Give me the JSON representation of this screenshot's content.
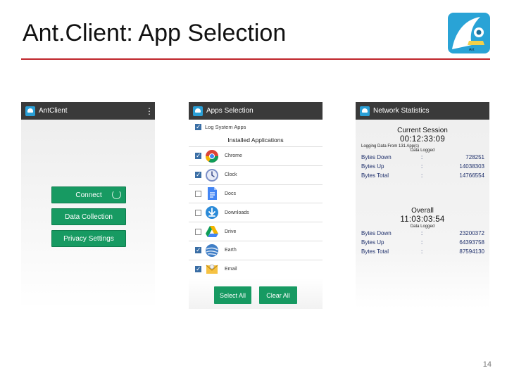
{
  "slide": {
    "title": "Ant.Client: App Selection",
    "page_number": "14",
    "logo_text": "Ant"
  },
  "phone1": {
    "bar_title": "AntClient",
    "menu_icon": "⋮",
    "buttons": [
      "Connect",
      "Data Collection",
      "Privacy Settings"
    ]
  },
  "phone2": {
    "bar_title": "Apps Selection",
    "log_system_apps": {
      "label": "Log System Apps",
      "checked": true
    },
    "section_label": "Installed Applications",
    "apps": [
      {
        "name": "Chrome",
        "checked": true,
        "icon": "chrome-icon"
      },
      {
        "name": "Clock",
        "checked": true,
        "icon": "clock-icon"
      },
      {
        "name": "Docs",
        "checked": false,
        "icon": "docs-icon"
      },
      {
        "name": "Downloads",
        "checked": false,
        "icon": "downloads-icon"
      },
      {
        "name": "Drive",
        "checked": false,
        "icon": "drive-icon"
      },
      {
        "name": "Earth",
        "checked": true,
        "icon": "earth-icon"
      },
      {
        "name": "Email",
        "checked": true,
        "icon": "email-icon"
      }
    ],
    "select_all": "Select All",
    "clear_all": "Clear All"
  },
  "phone3": {
    "bar_title": "Network Statistics",
    "current": {
      "heading": "Current Session",
      "time": "00:12:33:09",
      "note": "Logging Data From 131 App(s)",
      "sub": "Data Logged",
      "rows": [
        {
          "label": "Bytes Down",
          "sep": ":",
          "value": "728251"
        },
        {
          "label": "Bytes Up",
          "sep": ":",
          "value": "14038303"
        },
        {
          "label": "Bytes Total",
          "sep": ":",
          "value": "14766554"
        }
      ]
    },
    "overall": {
      "heading": "Overall",
      "time": "11:03:03:54",
      "sub": "Data Logged",
      "rows": [
        {
          "label": "Bytes Down",
          "sep": ":",
          "value": "23200372"
        },
        {
          "label": "Bytes Up",
          "sep": ":",
          "value": "64393758"
        },
        {
          "label": "Bytes Total",
          "sep": ":",
          "value": "87594130"
        }
      ]
    }
  },
  "colors": {
    "accent_green": "#179a62",
    "title_rule": "#c0262c",
    "app_bar": "#3a3a3a",
    "stat_text": "#1e2f6b"
  }
}
